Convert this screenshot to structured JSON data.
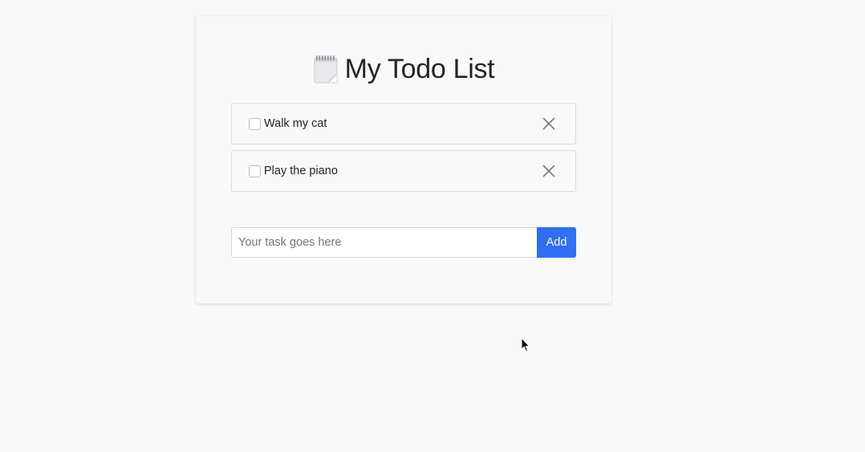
{
  "app": {
    "title": "My Todo List",
    "title_icon": "notepad-icon"
  },
  "todos": [
    {
      "label": "Walk my cat",
      "checked": false,
      "remove_icon": "close-icon"
    },
    {
      "label": "Play the piano",
      "checked": false,
      "remove_icon": "close-icon"
    }
  ],
  "form": {
    "placeholder": "Your task goes here",
    "value": "",
    "add_label": "Add"
  },
  "colors": {
    "accent": "#2f6ff2",
    "background": "#f9f9f9",
    "border": "#dcdcdc"
  }
}
